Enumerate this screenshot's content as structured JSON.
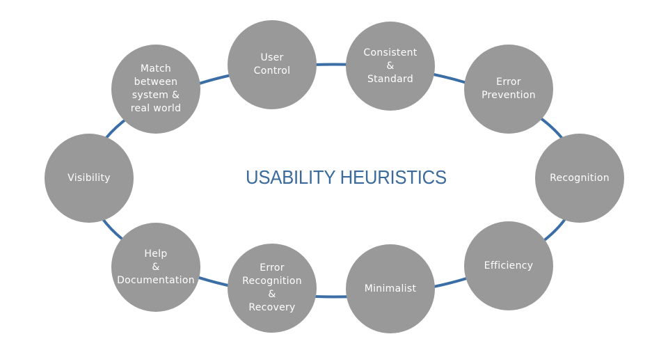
{
  "title": "USABILITY HEURISTICS",
  "colors": {
    "ring": "#3a6ea5",
    "node_fill": "#999999",
    "node_text": "#ffffff",
    "title": "#3b6b9c"
  },
  "heuristics": [
    {
      "id": "visibility",
      "label": "Visibility"
    },
    {
      "id": "match",
      "label": "Match\nbetween\nsystem &\nreal world"
    },
    {
      "id": "user-control",
      "label": "User\nControl"
    },
    {
      "id": "consistent",
      "label": "Consistent\n&\nStandard"
    },
    {
      "id": "error-prevention",
      "label": "Error\nPrevention"
    },
    {
      "id": "recognition",
      "label": "Recognition"
    },
    {
      "id": "efficiency",
      "label": "Efficiency"
    },
    {
      "id": "minimalist",
      "label": "Minimalist"
    },
    {
      "id": "error-recovery",
      "label": "Error\nRecognition\n&\nRecovery"
    },
    {
      "id": "help",
      "label": "Help\n&\nDocumentation"
    }
  ]
}
